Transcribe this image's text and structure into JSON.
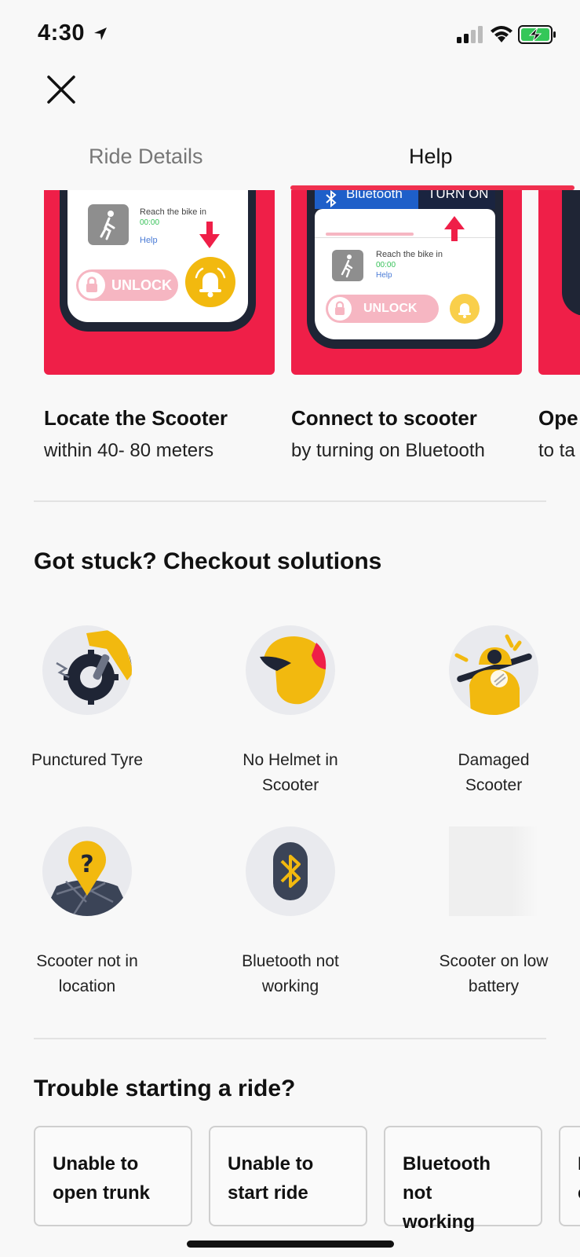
{
  "status": {
    "time": "4:30"
  },
  "tabs": [
    {
      "label": "Ride Details",
      "active": false
    },
    {
      "label": "Help",
      "active": true
    }
  ],
  "carousel": [
    {
      "title": "Locate the Scooter",
      "subtitle": "within 40- 80 meters",
      "mock": {
        "reach": "Reach the bike in",
        "timer": "00:00",
        "help": "Help",
        "unlock": "UNLOCK"
      }
    },
    {
      "title": "Connect to scooter",
      "subtitle": "by turning on Bluetooth",
      "mock": {
        "bluetooth": "Bluetooth",
        "turn_on": "TURN ON",
        "reach": "Reach the bike in",
        "timer": "00:00",
        "help": "Help",
        "unlock": "UNLOCK"
      }
    },
    {
      "title": "Ope",
      "subtitle": "to ta"
    }
  ],
  "solutions": {
    "title": "Got stuck? Checkout solutions",
    "items": [
      {
        "label": "Punctured Tyre",
        "icon": "punctured-tyre-icon"
      },
      {
        "label": "No Helmet in Scooter",
        "icon": "helmet-icon"
      },
      {
        "label": "Damaged Scooter",
        "icon": "damaged-scooter-icon"
      },
      {
        "label": "Scooter not in location",
        "icon": "location-question-icon"
      },
      {
        "label": "Bluetooth not working",
        "icon": "bluetooth-icon"
      },
      {
        "label": "Scooter on low battery",
        "icon": "low-battery-icon"
      }
    ]
  },
  "trouble": {
    "title": "Trouble starting a ride?",
    "cards": [
      {
        "line1": "Unable to",
        "line2": "open trunk"
      },
      {
        "line1": "Unable to",
        "line2": "start ride"
      },
      {
        "line1": "Bluetooth not",
        "line2": "working"
      },
      {
        "line1": "I",
        "line2": "e"
      }
    ]
  },
  "colors": {
    "accent": "#f0304f",
    "yellow": "#f2b90f",
    "navy": "#1f2535"
  }
}
